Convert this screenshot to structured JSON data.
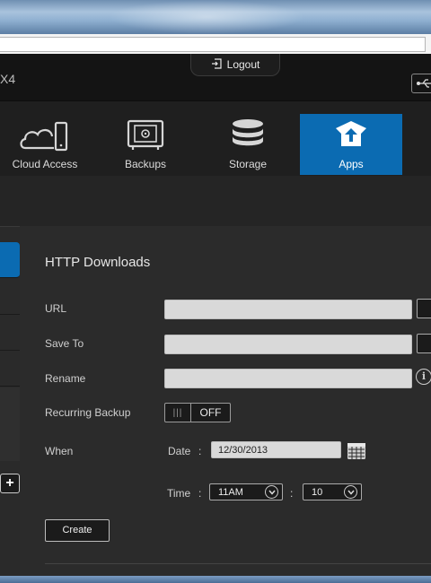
{
  "device": {
    "name_fragment": "X4"
  },
  "header": {
    "logout_label": "Logout"
  },
  "nav": [
    {
      "label": "Cloud Access",
      "icon": "cloud-device-icon",
      "active": false
    },
    {
      "label": "Backups",
      "icon": "safe-icon",
      "active": false
    },
    {
      "label": "Storage",
      "icon": "database-icon",
      "active": false
    },
    {
      "label": "Apps",
      "icon": "apps-upload-icon",
      "active": true
    }
  ],
  "form": {
    "title": "HTTP Downloads",
    "url_label": "URL",
    "url_value": "",
    "save_to_label": "Save To",
    "save_to_value": "",
    "rename_label": "Rename",
    "rename_value": "",
    "recurring_label": "Recurring Backup",
    "recurring_state": "OFF",
    "when_label": "When",
    "date_label": "Date",
    "date_sep": ":",
    "date_value": "12/30/2013",
    "time_label": "Time",
    "time_sep": ":",
    "hour_value": "11AM",
    "minute_sep": ":",
    "minute_value": "10",
    "create_label": "Create"
  },
  "colors": {
    "accent": "#0b6bb2",
    "background": "#2b2b2b",
    "header": "#141414"
  }
}
